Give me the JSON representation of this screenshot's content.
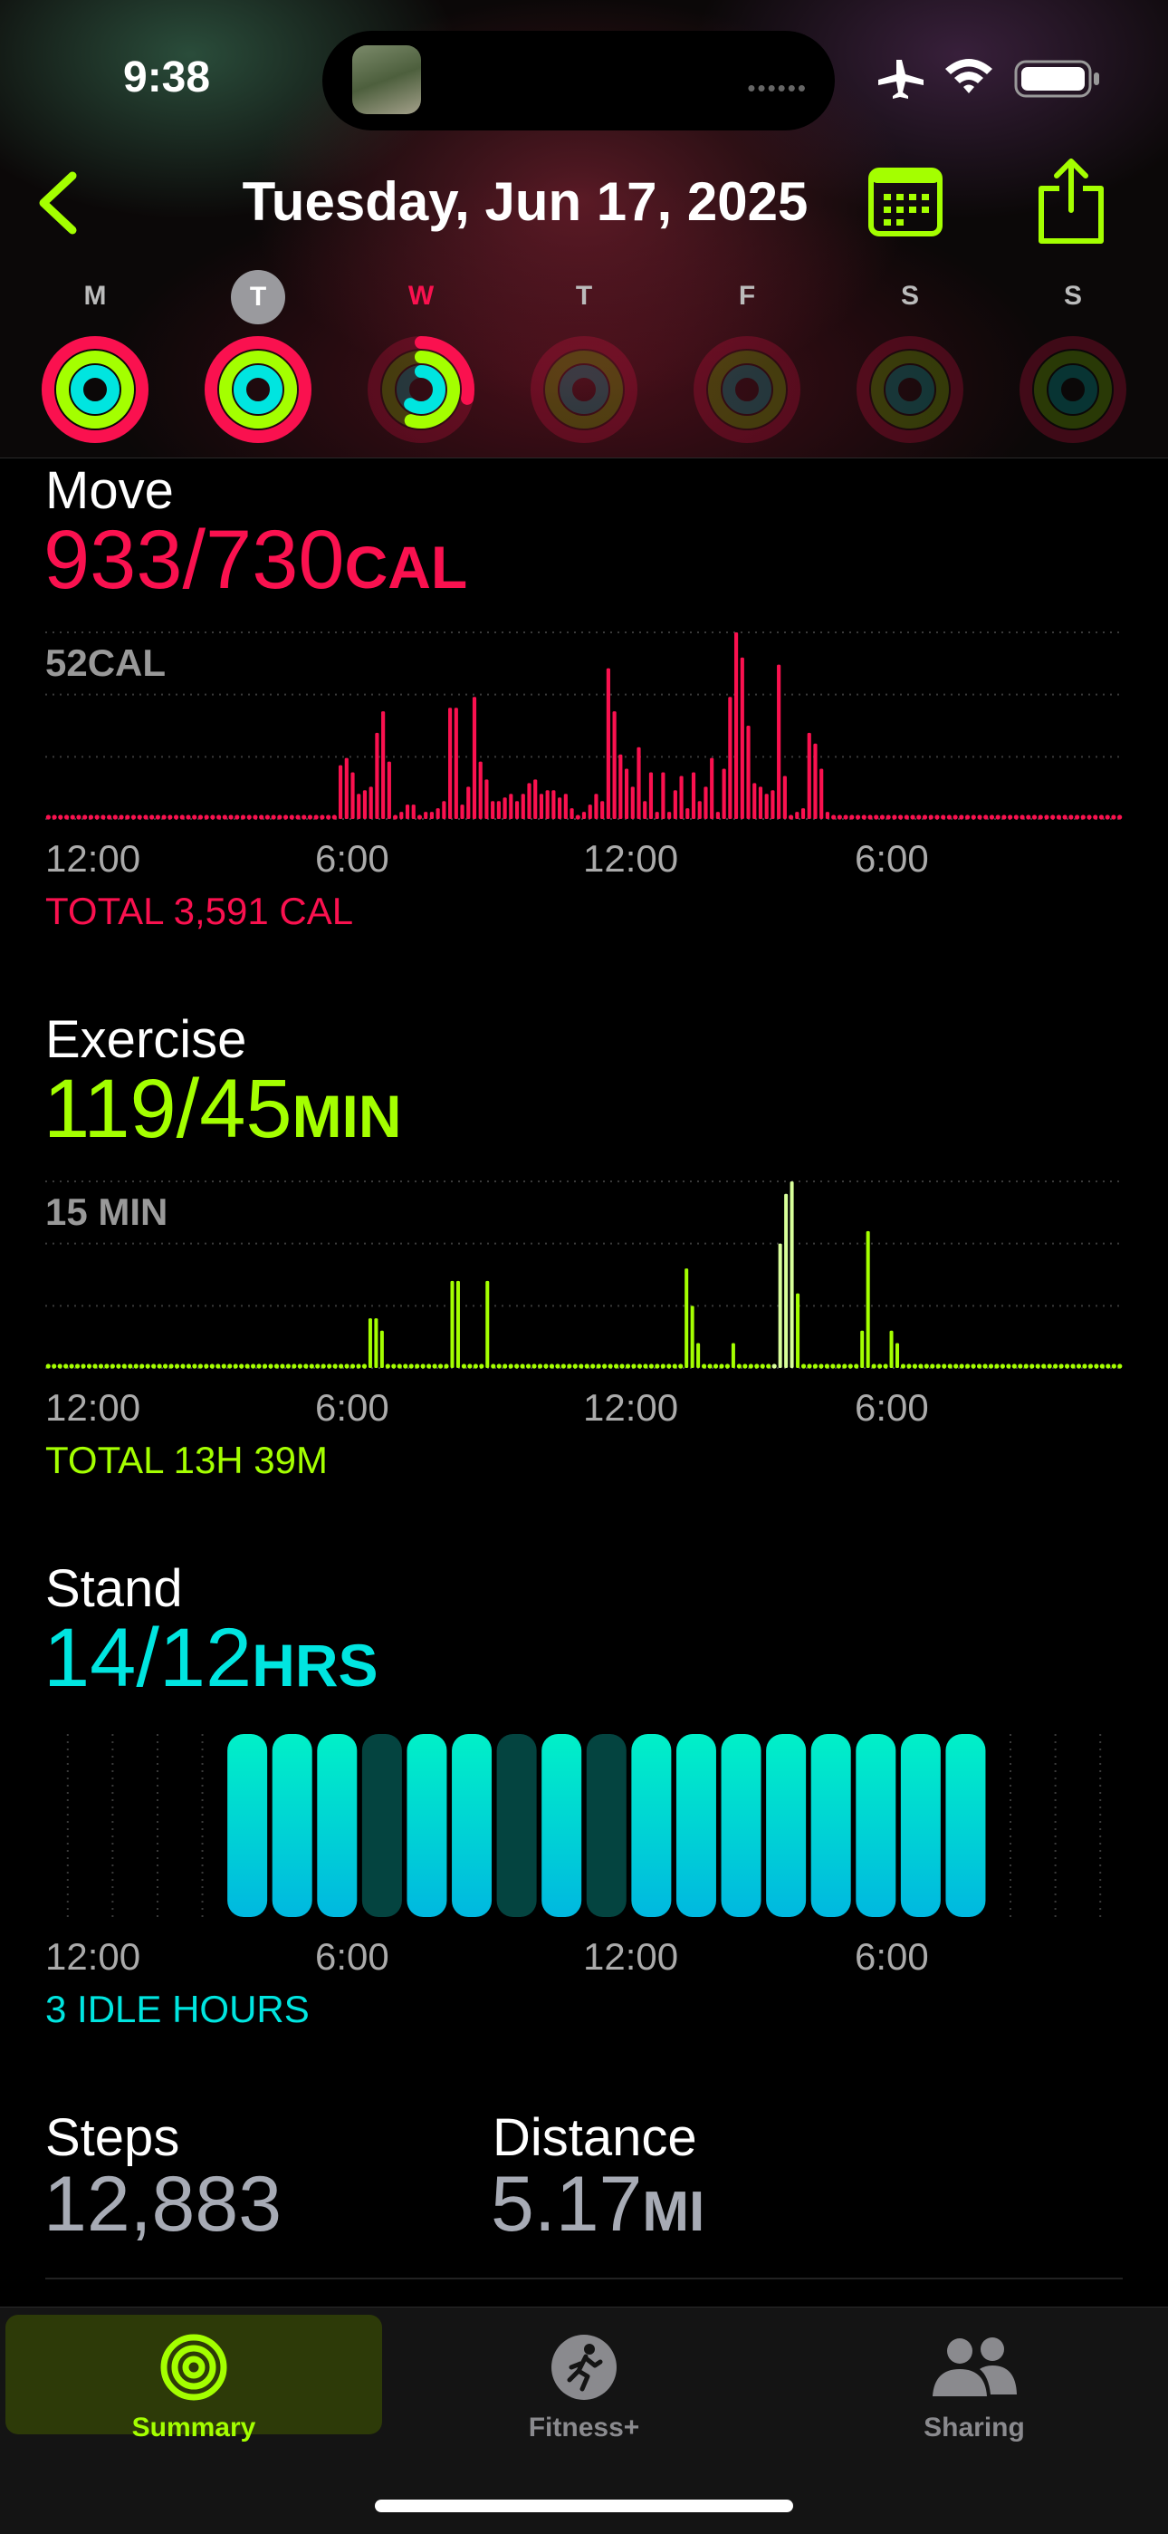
{
  "status_bar": {
    "time": "9:38"
  },
  "header": {
    "title": "Tuesday, Jun 17, 2025"
  },
  "week": [
    {
      "day": "M",
      "move": 1.25,
      "exercise": 1.0,
      "stand": 1.0
    },
    {
      "day": "T",
      "move": 1.28,
      "exercise": 1.0,
      "stand": 1.0,
      "selected": true
    },
    {
      "day": "W",
      "move": 0.28,
      "exercise": 0.55,
      "stand": 0.6,
      "today": true
    },
    {
      "day": "T",
      "move": 0,
      "exercise": 0,
      "stand": 0
    },
    {
      "day": "F",
      "move": 0,
      "exercise": 0,
      "stand": 0
    },
    {
      "day": "S",
      "move": 0,
      "exercise": 0,
      "stand": 0
    },
    {
      "day": "S",
      "move": 0,
      "exercise": 0,
      "stand": 0
    }
  ],
  "move": {
    "title": "Move",
    "value": "933/730",
    "unit": "CAL",
    "scale_label": "52CAL",
    "scale_max": 52,
    "total": "TOTAL 3,591 CAL",
    "color": "#fa114f",
    "values": [
      1,
      1,
      1,
      1,
      1,
      1,
      1,
      1,
      1,
      1,
      1,
      1,
      1,
      1,
      1,
      1,
      1,
      1,
      1,
      1,
      1,
      1,
      1,
      1,
      1,
      1,
      1,
      1,
      1,
      1,
      1,
      1,
      1,
      1,
      1,
      1,
      1,
      1,
      1,
      1,
      1,
      1,
      1,
      1,
      1,
      1,
      1,
      1,
      15,
      17,
      13,
      7,
      8,
      9,
      24,
      30,
      16,
      1,
      2,
      4,
      4,
      1,
      2,
      2,
      3,
      5,
      31,
      31,
      4,
      9,
      34,
      16,
      11,
      5,
      5,
      6,
      7,
      5,
      7,
      10,
      11,
      7,
      8,
      8,
      6,
      7,
      3,
      1,
      2,
      4,
      7,
      5,
      42,
      30,
      18,
      14,
      9,
      20,
      5,
      13,
      2,
      13,
      2,
      8,
      12,
      3,
      13,
      5,
      9,
      17,
      2,
      14,
      34,
      52,
      45,
      26,
      10,
      9,
      7,
      8,
      43,
      12,
      1,
      2,
      3,
      24,
      21,
      14,
      2,
      1,
      1,
      1,
      1,
      1,
      1,
      1,
      1,
      1,
      1,
      1,
      1,
      1,
      1,
      1,
      1,
      1,
      1,
      1,
      1,
      1,
      1,
      1,
      1,
      1,
      1,
      1,
      1,
      1,
      1,
      1,
      1,
      1,
      1,
      1,
      1,
      1,
      1,
      1,
      1,
      1,
      1,
      1,
      1,
      1,
      1,
      1,
      1
    ],
    "x_labels": [
      "12:00",
      "6:00",
      "12:00",
      "6:00"
    ]
  },
  "exercise": {
    "title": "Exercise",
    "value": "119/45",
    "unit": "MIN",
    "scale_label": "15 MIN",
    "scale_max": 15,
    "total": "TOTAL 13H 39M",
    "color": "#a4ff00",
    "highlight_color": "#d8ff9a",
    "values": [
      0,
      0,
      0,
      0,
      0,
      0,
      0,
      0,
      0,
      0,
      0,
      0,
      0,
      0,
      0,
      0,
      0,
      0,
      0,
      0,
      0,
      0,
      0,
      0,
      0,
      0,
      0,
      0,
      0,
      0,
      0,
      0,
      0,
      0,
      0,
      0,
      0,
      0,
      0,
      0,
      0,
      0,
      0,
      0,
      0,
      0,
      0,
      0,
      0,
      0,
      0,
      0,
      0,
      0,
      1,
      4,
      4,
      3,
      0,
      0,
      0,
      0,
      0,
      0,
      0,
      0,
      0,
      0,
      0,
      7,
      7,
      0,
      0,
      0,
      0,
      7,
      0,
      0,
      0,
      0,
      0,
      0,
      0,
      0,
      0,
      0,
      0,
      0,
      0,
      0,
      0,
      0,
      0,
      0,
      0,
      0,
      0,
      0,
      0,
      0,
      0,
      0,
      0,
      0,
      0,
      0,
      0,
      0,
      0,
      8,
      5,
      2,
      1,
      1,
      0,
      1,
      0,
      2,
      0,
      0,
      0,
      0,
      0,
      0,
      1,
      10,
      14,
      15,
      6,
      0,
      0,
      0,
      0,
      0,
      0,
      0,
      0,
      0,
      0,
      3,
      11,
      0,
      0,
      0,
      3,
      2,
      1,
      0,
      0,
      0,
      0,
      0,
      0,
      0,
      0,
      0,
      0,
      0,
      0,
      0,
      0,
      0,
      0,
      0,
      0,
      0,
      0,
      0,
      0,
      0,
      0,
      0,
      0,
      0,
      0,
      0,
      0,
      0,
      0,
      0,
      0,
      0,
      0,
      0
    ],
    "highlights": [
      124,
      125,
      126,
      127
    ],
    "x_labels": [
      "12:00",
      "6:00",
      "12:00",
      "6:00"
    ]
  },
  "stand": {
    "title": "Stand",
    "value": "14/12",
    "unit": "HRS",
    "note": "3 IDLE HOURS",
    "color": "#00e5e0",
    "hours": [
      0,
      0,
      0,
      0,
      1,
      1,
      1,
      0,
      1,
      1,
      0,
      1,
      0,
      1,
      1,
      1,
      1,
      1,
      1,
      1,
      1,
      0,
      0,
      0
    ],
    "x_labels": [
      "12:00",
      "6:00",
      "12:00",
      "6:00"
    ]
  },
  "stats": {
    "steps_label": "Steps",
    "steps_value": "12,883",
    "distance_label": "Distance",
    "distance_value": "5.17",
    "distance_unit": "MI"
  },
  "tabs": [
    {
      "label": "Summary",
      "active": true
    },
    {
      "label": "Fitness+"
    },
    {
      "label": "Sharing"
    }
  ],
  "colors": {
    "accent": "#a4ff00",
    "move": "#fa114f",
    "exercise": "#a4ff00",
    "stand": "#00e5e0"
  }
}
